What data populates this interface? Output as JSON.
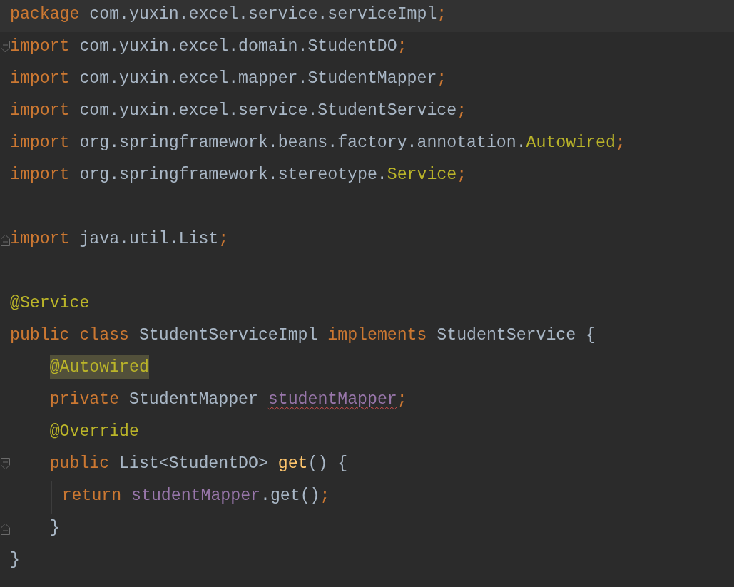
{
  "editor": {
    "lines": [
      {
        "kind": "code",
        "current": true,
        "tokens": [
          {
            "kind": "keyword",
            "text": "package"
          },
          {
            "kind": "plain",
            "text": " com.yuxin.excel.service.serviceImpl"
          },
          {
            "kind": "punct",
            "text": ";"
          }
        ]
      },
      {
        "kind": "code",
        "fold_start": true,
        "tokens": [
          {
            "kind": "keyword",
            "text": "import"
          },
          {
            "kind": "plain",
            "text": " com.yuxin.excel.domain.StudentDO"
          },
          {
            "kind": "punct",
            "text": ";"
          }
        ]
      },
      {
        "kind": "code",
        "tokens": [
          {
            "kind": "keyword",
            "text": "import"
          },
          {
            "kind": "plain",
            "text": " com.yuxin.excel.mapper.StudentMapper"
          },
          {
            "kind": "punct",
            "text": ";"
          }
        ]
      },
      {
        "kind": "code",
        "tokens": [
          {
            "kind": "keyword",
            "text": "import"
          },
          {
            "kind": "plain",
            "text": " com.yuxin.excel.service.StudentService"
          },
          {
            "kind": "punct",
            "text": ";"
          }
        ]
      },
      {
        "kind": "code",
        "tokens": [
          {
            "kind": "keyword",
            "text": "import"
          },
          {
            "kind": "plain",
            "text": " org.springframework.beans.factory.annotation."
          },
          {
            "kind": "annotation",
            "text": "Autowired"
          },
          {
            "kind": "punct",
            "text": ";"
          }
        ]
      },
      {
        "kind": "code",
        "tokens": [
          {
            "kind": "keyword",
            "text": "import"
          },
          {
            "kind": "plain",
            "text": " org.springframework.stereotype."
          },
          {
            "kind": "annotation",
            "text": "Service"
          },
          {
            "kind": "punct",
            "text": ";"
          }
        ]
      },
      {
        "kind": "blank"
      },
      {
        "kind": "code",
        "fold_end": true,
        "tokens": [
          {
            "kind": "keyword",
            "text": "import"
          },
          {
            "kind": "plain",
            "text": " java.util.List"
          },
          {
            "kind": "punct",
            "text": ";"
          }
        ]
      },
      {
        "kind": "blank"
      },
      {
        "kind": "code",
        "tokens": [
          {
            "kind": "annotation",
            "text": "@Service"
          }
        ]
      },
      {
        "kind": "code",
        "tokens": [
          {
            "kind": "keyword",
            "text": "public"
          },
          {
            "kind": "keyword",
            "text": " class"
          },
          {
            "kind": "plain",
            "text": " StudentServiceImpl"
          },
          {
            "kind": "keyword",
            "text": " implements"
          },
          {
            "kind": "plain",
            "text": " StudentService {"
          }
        ],
        "children": [
          {
            "kind": "code",
            "tokens": [
              {
                "kind": "annotation",
                "text": "@Autowired",
                "highlighted": true
              }
            ]
          },
          {
            "kind": "code",
            "tokens": [
              {
                "kind": "keyword",
                "text": "private"
              },
              {
                "kind": "plain",
                "text": " StudentMapper "
              },
              {
                "kind": "field",
                "text": "studentMapper",
                "error": true
              },
              {
                "kind": "punct",
                "text": ";"
              }
            ]
          },
          {
            "kind": "code",
            "tokens": [
              {
                "kind": "annotation",
                "text": "@Override"
              }
            ]
          },
          {
            "kind": "code",
            "fold_start": true,
            "tokens": [
              {
                "kind": "keyword",
                "text": "public"
              },
              {
                "kind": "plain",
                "text": " List<StudentDO> "
              },
              {
                "kind": "method",
                "text": "get"
              },
              {
                "kind": "plain",
                "text": "() {"
              }
            ],
            "children": [
              {
                "kind": "code",
                "tokens": [
                  {
                    "kind": "keyword",
                    "text": "return"
                  },
                  {
                    "kind": "field",
                    "text": " studentMapper"
                  },
                  {
                    "kind": "plain",
                    "text": ".get()"
                  },
                  {
                    "kind": "punct",
                    "text": ";"
                  }
                ]
              }
            ]
          },
          {
            "kind": "code",
            "fold_end": true,
            "tokens": [
              {
                "kind": "plain",
                "text": "}"
              }
            ]
          }
        ]
      },
      {
        "kind": "code",
        "tokens": [
          {
            "kind": "plain",
            "text": "}"
          }
        ]
      }
    ]
  }
}
